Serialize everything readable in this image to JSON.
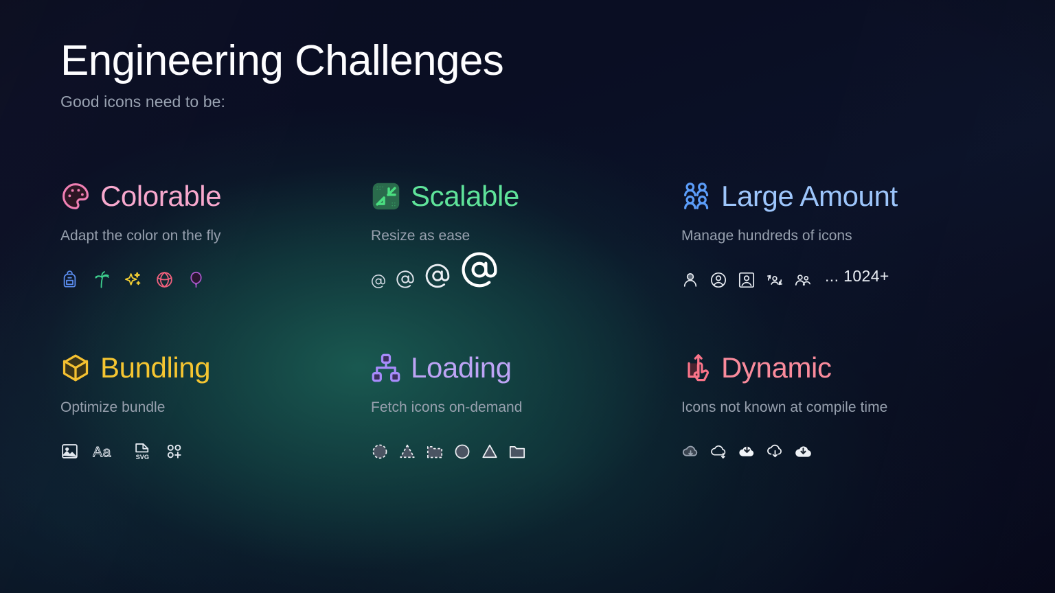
{
  "header": {
    "title": "Engineering Challenges",
    "subtitle": "Good icons need to be:"
  },
  "colors": {
    "background_top": "#0a0d22",
    "background_glow": "#1a5c52",
    "title_text": "#fdfdff",
    "subtitle_text": "#9aa3b2",
    "description_text": "#97a0ae",
    "accent_colorable": "#f7a8cd",
    "accent_scalable": "#5fe39a",
    "accent_large_amount": "#9dc5fb",
    "accent_bundling": "#f5c531",
    "accent_loading": "#bda4f5",
    "accent_dynamic": "#fa8b9c"
  },
  "cards": [
    {
      "id": "colorable",
      "title": "Colorable",
      "description": "Adapt the color on the fly",
      "header_icon": "palette-icon",
      "accent": "#f7a8cd",
      "sample_icons": [
        {
          "name": "backpack-icon",
          "color": "#5b8def"
        },
        {
          "name": "palm-tree-icon",
          "color": "#3ecf8e"
        },
        {
          "name": "sparkles-icon",
          "color": "#f5d033"
        },
        {
          "name": "beach-ball-icon",
          "color": "#f0607d"
        },
        {
          "name": "balloon-icon",
          "color": "#a855c8"
        }
      ]
    },
    {
      "id": "scalable",
      "title": "Scalable",
      "description": "Resize as ease",
      "header_icon": "shrink-arrows-icon",
      "accent": "#5fe39a",
      "sample_icons": [
        {
          "name": "at-sign-icon-xs",
          "size": 22
        },
        {
          "name": "at-sign-icon-sm",
          "size": 28
        },
        {
          "name": "at-sign-icon-md",
          "size": 38
        },
        {
          "name": "at-sign-icon-lg",
          "size": 56
        }
      ]
    },
    {
      "id": "large-amount",
      "title": "Large Amount",
      "description": "Manage hundreds of icons",
      "header_icon": "users-group-icon",
      "accent": "#9dc5fb",
      "count_label": "... 1024+",
      "sample_icons": [
        {
          "name": "user-icon"
        },
        {
          "name": "user-circle-icon"
        },
        {
          "name": "user-square-icon"
        },
        {
          "name": "user-sync-icon"
        },
        {
          "name": "users-two-icon"
        }
      ]
    },
    {
      "id": "bundling",
      "title": "Bundling",
      "description": "Optimize bundle",
      "header_icon": "box-3d-icon",
      "accent": "#f5c531",
      "sample_icons": [
        {
          "name": "image-icon"
        },
        {
          "name": "typography-aa-icon",
          "label": "Aa"
        },
        {
          "name": "svg-file-icon",
          "label": "SVG"
        },
        {
          "name": "add-dots-icon"
        }
      ]
    },
    {
      "id": "loading",
      "title": "Loading",
      "description": "Fetch icons on-demand",
      "header_icon": "sitemap-icon",
      "accent": "#bda4f5",
      "sample_icons": [
        {
          "name": "circle-dashed-icon"
        },
        {
          "name": "triangle-dashed-icon"
        },
        {
          "name": "folder-dashed-icon"
        },
        {
          "name": "circle-outline-icon"
        },
        {
          "name": "triangle-outline-icon"
        },
        {
          "name": "folder-outline-icon"
        }
      ]
    },
    {
      "id": "dynamic",
      "title": "Dynamic",
      "description": "Icons not known at compile time",
      "header_icon": "swipe-up-hand-icon",
      "accent": "#fa8b9c",
      "sample_icons": [
        {
          "name": "cloud-download-dim-icon"
        },
        {
          "name": "cloud-download-thin-icon"
        },
        {
          "name": "cloud-download-filled-icon"
        },
        {
          "name": "cloud-download-outline-icon"
        },
        {
          "name": "cloud-download-solid-icon"
        }
      ]
    }
  ]
}
